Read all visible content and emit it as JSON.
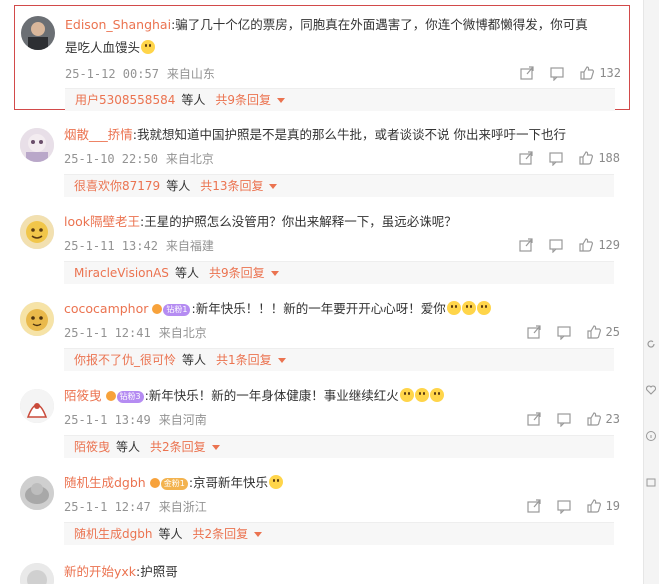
{
  "comments": [
    {
      "user": "Edison_Shanghai",
      "text_line1": ":骗了几十个亿的票房，同胞真在外面遇害了，你连个微博都懒得发，你可真",
      "text_line2": "是吃人血馒头",
      "time": "25-1-12 00:57",
      "location": "来自山东",
      "likes": "132",
      "reply_user": "用户5308558584",
      "dengren": "等人",
      "reply_count": "共9条回复"
    },
    {
      "user": "烟散___挢情",
      "text_line1": ":我就想知道中国护照是不是真的那么牛批，或者谈谈不说 你出来呼吁一下也行",
      "time": "25-1-10 22:50",
      "location": "来自北京",
      "likes": "188",
      "reply_user": "很喜欢你87179",
      "dengren": "等人",
      "reply_count": "共13条回复"
    },
    {
      "user": "look隔壁老王",
      "text_line1": ":王星的护照怎么没管用？你出来解释一下，虽远必诛呢？",
      "time": "25-1-11 13:42",
      "location": "来自福建",
      "likes": "129",
      "reply_user": "MiracleVisionAS",
      "dengren": "等人",
      "reply_count": "共9条回复"
    },
    {
      "user": "cococamphor",
      "badge": "钻粉1",
      "text_line1": ":新年快乐！！！新的一年要开开心心呀！爱你",
      "time": "25-1-1 12:41",
      "location": "来自北京",
      "likes": "25",
      "reply_user": "你报不了仇_很可怜",
      "dengren": "等人",
      "reply_count": "共1条回复"
    },
    {
      "user": "陌筱曳",
      "badge": "钻粉3",
      "text_line1": ":新年快乐！新的一年身体健康！事业继续红火",
      "time": "25-1-1 13:49",
      "location": "来自河南",
      "likes": "23",
      "reply_user": "陌筱曳",
      "dengren": "等人",
      "reply_count": "共2条回复"
    },
    {
      "user": "随机生成dgbh",
      "badge": "金粉1",
      "text_line1": ":京哥新年快乐",
      "time": "25-1-1 12:47",
      "location": "来自浙江",
      "likes": "19",
      "reply_user": "随机生成dgbh",
      "dengren": "等人",
      "reply_count": "共2条回复"
    },
    {
      "user": "新的开始yxk",
      "text_line1": ":护照哥"
    }
  ],
  "colors": {
    "username": "#eb7350",
    "meta": "#939393",
    "highlight_border": "#d24a4a"
  }
}
